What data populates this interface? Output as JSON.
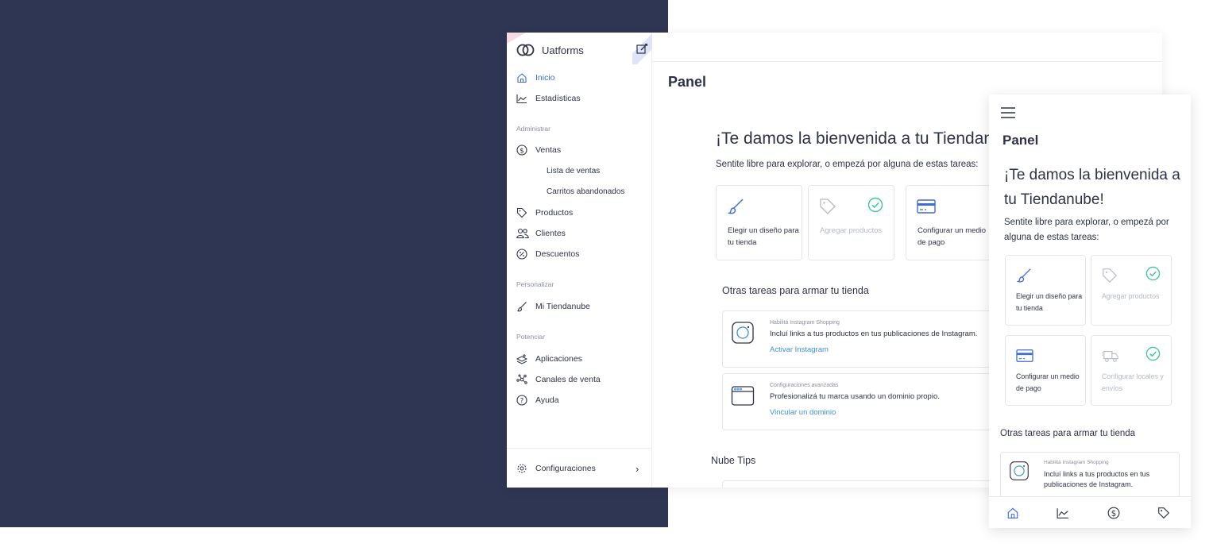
{
  "colors": {
    "background": "#2e3654",
    "accent": "#3d6bd8",
    "link": "#3d8fd8",
    "check": "#3fc3a0",
    "text": "#2d3347"
  },
  "desktop": {
    "brand": "Uatforms",
    "nav": {
      "inicio": "Inicio",
      "estadisticas": "Estadísticas",
      "section_administrar": "Administrar",
      "ventas": "Ventas",
      "lista_ventas": "Lista de ventas",
      "carritos": "Carritos abandonados",
      "productos": "Productos",
      "clientes": "Clientes",
      "descuentos": "Descuentos",
      "section_personalizar": "Personalizar",
      "mi_tiendanube": "Mi Tiendanube",
      "section_potenciar": "Potenciar",
      "aplicaciones": "Aplicaciones",
      "canales": "Canales de venta",
      "ayuda": "Ayuda",
      "configuraciones": "Configuraciones"
    },
    "page_title": "Panel",
    "welcome": "¡Te damos la bienvenida a tu Tiendanube!",
    "welcome_sub": "Sentite libre para explorar, o empezá por alguna de estas tareas:",
    "tasks": [
      {
        "label": "Elegir un diseño para tu tienda",
        "icon": "brush-icon",
        "done": false
      },
      {
        "label": "Agregar productos",
        "icon": "tag-icon",
        "done": true
      },
      {
        "label": "Configurar un medio de pago",
        "icon": "credit-card-icon",
        "done": false
      }
    ],
    "other_title": "Otras tareas para armar tu tienda",
    "other_tasks": [
      {
        "eyebrow": "Habilitá Instagram Shopping",
        "text": "Incluí links a tus productos en tus publicaciones de Instagram.",
        "link": "Activar Instagram",
        "icon": "instagram-icon"
      },
      {
        "eyebrow": "Configuraciones avanzadas",
        "text": "Profesionalizá tu marca usando un dominio propio.",
        "link": "Vincular un dominio",
        "icon": "browser-window-icon"
      }
    ],
    "nube_tips": "Nube Tips"
  },
  "mobile": {
    "page_title": "Panel",
    "welcome": "¡Te damos la bienvenida a tu Tiendanube!",
    "welcome_sub": "Sentite libre para explorar, o empezá por alguna de estas tareas:",
    "tasks": [
      {
        "label": "Elegir un diseño para tu tienda",
        "icon": "brush-icon",
        "done": false
      },
      {
        "label": "Agregar productos",
        "icon": "tag-icon",
        "done": true
      },
      {
        "label": "Configurar un medio de pago",
        "icon": "credit-card-icon",
        "done": false
      },
      {
        "label": "Configurar locales y envíos",
        "icon": "truck-icon",
        "done": true
      }
    ],
    "other_title": "Otras tareas para armar tu tienda",
    "other_task": {
      "eyebrow": "Habilitá Instagram Shopping",
      "text": "Incluí links a tus productos en tus publicaciones de Instagram.",
      "icon": "instagram-icon"
    },
    "tabbar": [
      "home-icon",
      "chart-icon",
      "dollar-icon",
      "tag-icon"
    ]
  }
}
